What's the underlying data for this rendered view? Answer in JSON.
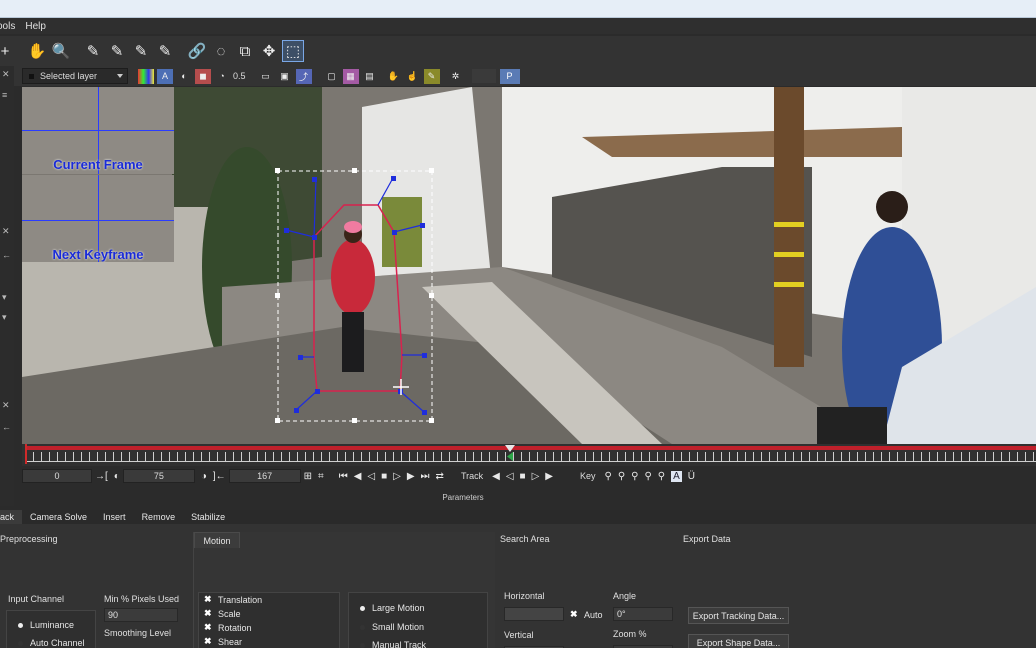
{
  "menu": [
    "ools",
    "Help"
  ],
  "toolbar2": {
    "layer_select": "Selected layer",
    "value": "0.5",
    "p_button": "P"
  },
  "viewer": {
    "magnifier_current": "Current Frame",
    "magnifier_next": "Next Keyframe"
  },
  "transport": {
    "start_frame": "0",
    "mid_frame": "75",
    "end_frame": "167",
    "track_label": "Track",
    "key_label": "Key"
  },
  "timeline": {
    "playhead_position": 0.48
  },
  "params_label": "Parameters",
  "tabs": [
    "rack",
    "Camera Solve",
    "Insert",
    "Remove",
    "Stabilize"
  ],
  "panel": {
    "preprocessing_title": "Preprocessing",
    "input_channel_label": "Input Channel",
    "channels": [
      "Luminance",
      "Auto Channel"
    ],
    "min_pixels_label": "Min % Pixels Used",
    "min_pixels_value": "90",
    "smoothing_label": "Smoothing Level",
    "motion_tab": "Motion",
    "motion_options": [
      "Translation",
      "Scale",
      "Rotation",
      "Shear"
    ],
    "motion_modes": [
      "Large Motion",
      "Small Motion",
      "Manual Track"
    ],
    "search_area_title": "Search Area",
    "horizontal_label": "Horizontal",
    "auto_label": "Auto",
    "vertical_label": "Vertical",
    "angle_label": "Angle",
    "angle_value": "0°",
    "zoom_label": "Zoom %",
    "export_title": "Export Data",
    "export_tracking": "Export Tracking Data...",
    "export_shape": "Export Shape Data..."
  },
  "colors": {
    "accent_blue": "#1f2ddc",
    "spline_red": "#d8224e",
    "timeline_red": "#c0202b"
  }
}
